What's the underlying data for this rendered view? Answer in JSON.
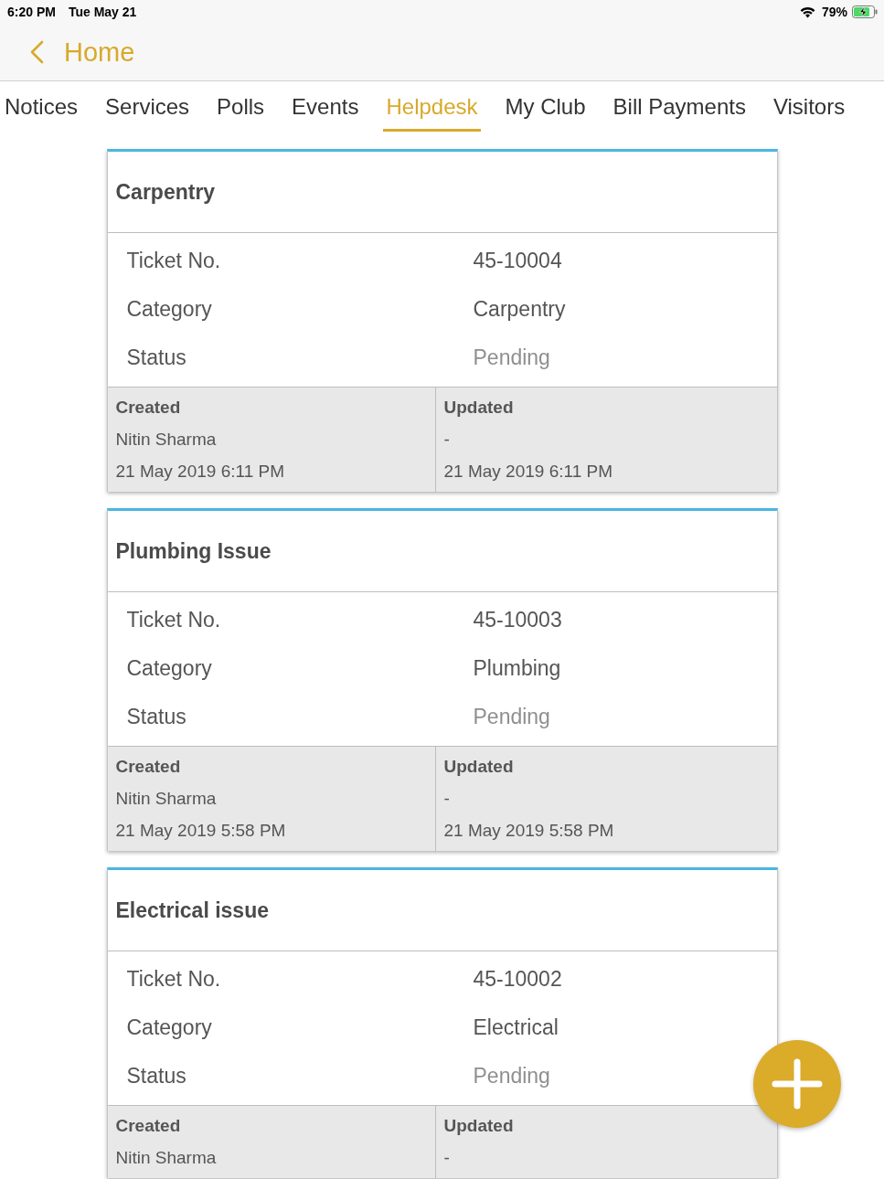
{
  "status_bar": {
    "time": "6:20 PM",
    "date": "Tue May 21",
    "battery": "79%",
    "charging": true
  },
  "nav": {
    "back_label": "Home"
  },
  "tabs": [
    {
      "label": "Notices",
      "selected": false
    },
    {
      "label": "Services",
      "selected": false
    },
    {
      "label": "Polls",
      "selected": false
    },
    {
      "label": "Events",
      "selected": false
    },
    {
      "label": "Helpdesk",
      "selected": true
    },
    {
      "label": "My Club",
      "selected": false
    },
    {
      "label": "Bill Payments",
      "selected": false
    },
    {
      "label": "Visitors",
      "selected": false
    }
  ],
  "tickets": [
    {
      "title": "Carpentry",
      "fields": [
        {
          "label": "Ticket No.",
          "value": "45-10004",
          "kind": "text"
        },
        {
          "label": "Category",
          "value": "Carpentry",
          "kind": "text"
        },
        {
          "label": "Status",
          "value": "Pending",
          "kind": "status"
        }
      ],
      "created": {
        "heading": "Created",
        "by": "Nitin Sharma",
        "time": "21 May 2019 6:11 PM"
      },
      "updated": {
        "heading": "Updated",
        "by": "-",
        "time": "21 May 2019 6:11 PM"
      }
    },
    {
      "title": "Plumbing Issue",
      "fields": [
        {
          "label": "Ticket No.",
          "value": "45-10003",
          "kind": "text"
        },
        {
          "label": "Category",
          "value": "Plumbing",
          "kind": "text"
        },
        {
          "label": "Status",
          "value": "Pending",
          "kind": "status"
        }
      ],
      "created": {
        "heading": "Created",
        "by": "Nitin Sharma",
        "time": "21 May 2019 5:58 PM"
      },
      "updated": {
        "heading": "Updated",
        "by": "-",
        "time": "21 May 2019 5:58 PM"
      }
    },
    {
      "title": "Electrical issue",
      "fields": [
        {
          "label": "Ticket No.",
          "value": "45-10002",
          "kind": "text"
        },
        {
          "label": "Category",
          "value": "Electrical",
          "kind": "text"
        },
        {
          "label": "Status",
          "value": "Pending",
          "kind": "status"
        }
      ],
      "created": {
        "heading": "Created",
        "by": "Nitin Sharma"
      },
      "updated": {
        "heading": "Updated",
        "by": "-"
      }
    }
  ]
}
